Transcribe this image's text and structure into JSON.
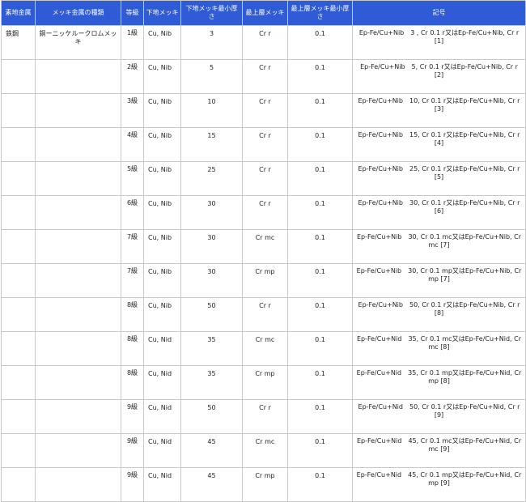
{
  "headers": {
    "substrate": "素地金属",
    "type": "メッキ金属の種類",
    "grade": "等級",
    "under": "下地メッキ",
    "under_min": "下地メッキ最小厚さ",
    "top": "最上層メッキ",
    "top_min": "最上層メッキ最小厚さ",
    "code": "記号"
  },
  "group": {
    "substrate": "鉄鋼",
    "type": "銅ーニッケルークロムメッキ"
  },
  "rows": [
    {
      "grade": "1級",
      "under": "Cu, Nib",
      "under_min": "3",
      "top": "Cr r",
      "top_min": "0.1",
      "code": "Ep-Fe/Cu+Nib　3 , Cr 0.1 r又はEp-Fe/Cu+Nib, Cr r [1]"
    },
    {
      "grade": "2級",
      "under": "Cu, Nib",
      "under_min": "5",
      "top": "Cr r",
      "top_min": "0.1",
      "code": "Ep-Fe/Cu+Nib　5, Cr 0.1 r又はEp-Fe/Cu+Nib, Cr r [2]"
    },
    {
      "grade": "3級",
      "under": "Cu, Nib",
      "under_min": "10",
      "top": "Cr r",
      "top_min": "0.1",
      "code": "Ep-Fe/Cu+Nib　10, Cr 0.1 r又はEp-Fe/Cu+Nib, Cr r [3]"
    },
    {
      "grade": "4級",
      "under": "Cu, Nib",
      "under_min": "15",
      "top": "Cr r",
      "top_min": "0.1",
      "code": "Ep-Fe/Cu+Nib　15, Cr 0.1 r又はEp-Fe/Cu+Nib, Cr r [4]"
    },
    {
      "grade": "5級",
      "under": "Cu, Nib",
      "under_min": "25",
      "top": "Cr r",
      "top_min": "0.1",
      "code": "Ep-Fe/Cu+Nib　25, Cr 0.1 r又はEp-Fe/Cu+Nib, Cr r [5]"
    },
    {
      "grade": "6級",
      "under": "Cu, Nib",
      "under_min": "30",
      "top": "Cr r",
      "top_min": "0.1",
      "code": "Ep-Fe/Cu+Nib　30, Cr 0.1 r又はEp-Fe/Cu+Nib, Cr r [6]"
    },
    {
      "grade": "7級",
      "under": "Cu, Nib",
      "under_min": "30",
      "top": "Cr mc",
      "top_min": "0.1",
      "code": "Ep-Fe/Cu+Nib　30, Cr 0.1 mc又はEp-Fe/Cu+Nib, Cr mc [7]"
    },
    {
      "grade": "7級",
      "under": "Cu, Nib",
      "under_min": "30",
      "top": "Cr mp",
      "top_min": "0.1",
      "code": "Ep-Fe/Cu+Nib　30, Cr 0.1 mp又はEp-Fe/Cu+Nib, Cr mp [7]"
    },
    {
      "grade": "8級",
      "under": "Cu, Nib",
      "under_min": "50",
      "top": "Cr r",
      "top_min": "0.1",
      "code": "Ep-Fe/Cu+Nib　50, Cr 0.1 r又はEp-Fe/Cu+Nib, Cr r [8]"
    },
    {
      "grade": "8級",
      "under": "Cu, Nid",
      "under_min": "35",
      "top": "Cr mc",
      "top_min": "0.1",
      "code": "Ep-Fe/Cu+Nid　35, Cr 0.1 mc又はEp-Fe/Cu+Nid, Cr mc [8]"
    },
    {
      "grade": "8級",
      "under": "Cu, Nid",
      "under_min": "35",
      "top": "Cr mp",
      "top_min": "0.1",
      "code": "Ep-Fe/Cu+Nid　35, Cr 0.1 mp又はEp-Fe/Cu+Nid, Cr mp [8]"
    },
    {
      "grade": "9級",
      "under": "Cu, Nid",
      "under_min": "50",
      "top": "Cr r",
      "top_min": "0.1",
      "code": "Ep-Fe/Cu+Nid　50, Cr 0.1 r又はEp-Fe/Cu+Nid, Cr r [9]"
    },
    {
      "grade": "9級",
      "under": "Cu, Nid",
      "under_min": "45",
      "top": "Cr mc",
      "top_min": "0.1",
      "code": "Ep-Fe/Cu+Nid　45, Cr 0.1 mc又はEp-Fe/Cu+Nid, Cr mc [9]"
    },
    {
      "grade": "9級",
      "under": "Cu, Nid",
      "under_min": "45",
      "top": "Cr mp",
      "top_min": "0.1",
      "code": "Ep-Fe/Cu+Nid　45, Cr 0.1 mp又はEp-Fe/Cu+Nid, Cr mp [9]"
    }
  ],
  "colors": {
    "header_bg": "#2f5bd6",
    "header_text": "#ffffff",
    "border": "#c9c9c9"
  }
}
